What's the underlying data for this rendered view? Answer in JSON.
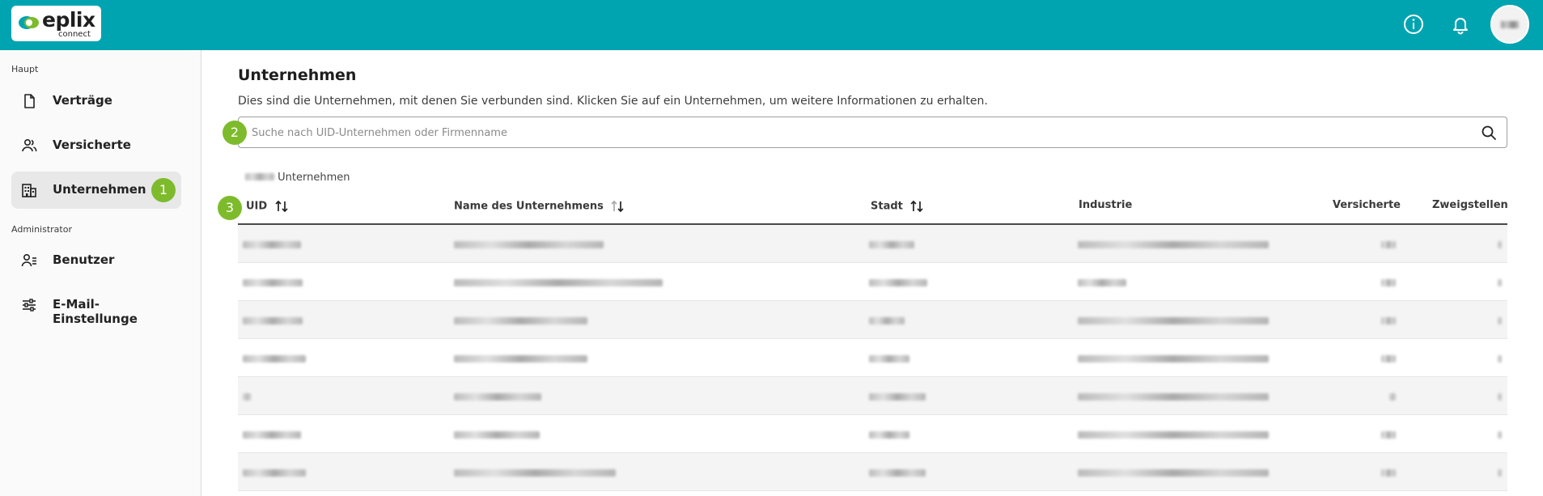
{
  "header": {
    "logo_text": "eplix",
    "logo_subtext": "connect",
    "icons": [
      "info-icon",
      "bell-icon"
    ],
    "accent_color": "#00a4b1"
  },
  "sidebar": {
    "section_main": "Haupt",
    "section_admin": "Administrator",
    "items": [
      {
        "label": "Verträge",
        "icon": "document-icon"
      },
      {
        "label": "Versicherte",
        "icon": "users-icon"
      },
      {
        "label": "Unternehmen",
        "icon": "building-icon",
        "active": true,
        "badge": "1"
      },
      {
        "label": "Benutzer",
        "icon": "user-manage-icon"
      },
      {
        "label": "E-Mail-Einstellunge",
        "icon": "sliders-icon"
      }
    ]
  },
  "main": {
    "title": "Unternehmen",
    "description": "Dies sind die Unternehmen, mit denen Sie verbunden sind. Klicken Sie auf ein Unternehmen, um weitere Informationen zu erhalten.",
    "search_placeholder": "Suche nach UID-Unternehmen oder Firmenname",
    "search_badge": "2",
    "count_label": "Unternehmen",
    "table_badge": "3",
    "columns": [
      "UID",
      "Name des Unternehmens",
      "Stadt",
      "Industrie",
      "Versicherte",
      "Zweigstellen"
    ],
    "row_count": 7
  },
  "colors": {
    "badge": "#7dbb2c",
    "active_nav": "#e8e8e8"
  }
}
